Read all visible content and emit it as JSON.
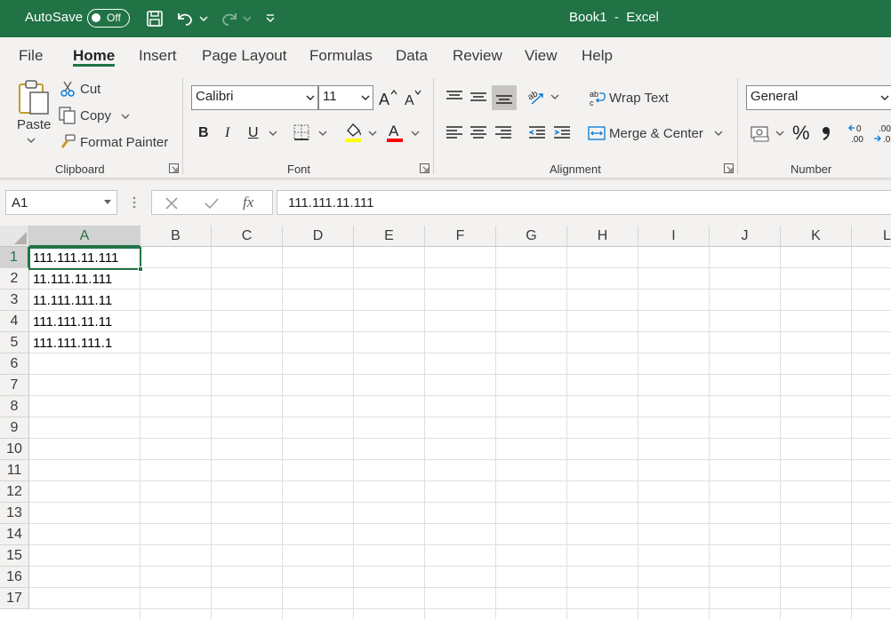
{
  "titlebar": {
    "autosave_label": "AutoSave",
    "autosave_state": "Off",
    "title": "Book1  -  Excel"
  },
  "tabs": [
    {
      "label": "File"
    },
    {
      "label": "Home",
      "active": true
    },
    {
      "label": "Insert"
    },
    {
      "label": "Page Layout"
    },
    {
      "label": "Formulas"
    },
    {
      "label": "Data"
    },
    {
      "label": "Review"
    },
    {
      "label": "View"
    },
    {
      "label": "Help"
    }
  ],
  "clipboard": {
    "group_label": "Clipboard",
    "paste": "Paste",
    "cut": "Cut",
    "copy": "Copy",
    "format_painter": "Format Painter"
  },
  "font": {
    "group_label": "Font",
    "font_name": "Calibri",
    "font_size": "11",
    "bold": "B",
    "italic": "I",
    "underline": "U",
    "font_color_letter": "A"
  },
  "alignment": {
    "group_label": "Alignment",
    "wrap_text": "Wrap Text",
    "merge_center": "Merge & Center"
  },
  "number": {
    "group_label": "Number",
    "format": "General",
    "percent": "%"
  },
  "formula_bar": {
    "name_box": "A1",
    "fx": "fx",
    "formula": "111.111.11.111"
  },
  "sheet": {
    "columns": [
      "A",
      "B",
      "C",
      "D",
      "E",
      "F",
      "G",
      "H",
      "I",
      "J",
      "K",
      "L"
    ],
    "rows": [
      "1",
      "2",
      "3",
      "4",
      "5",
      "6",
      "7",
      "8",
      "9",
      "10",
      "11",
      "12",
      "13",
      "14",
      "15",
      "16",
      "17"
    ],
    "cells_A": [
      "111.111.11.111",
      "11.111.11.111",
      "11.111.111.11",
      "111.111.11.11",
      "111.111.111.1"
    ]
  },
  "colors": {
    "brand": "#217346",
    "ribbon_bg": "#f3f2f1",
    "highlight_yellow": "#ffff00",
    "font_red": "#ff0000"
  }
}
